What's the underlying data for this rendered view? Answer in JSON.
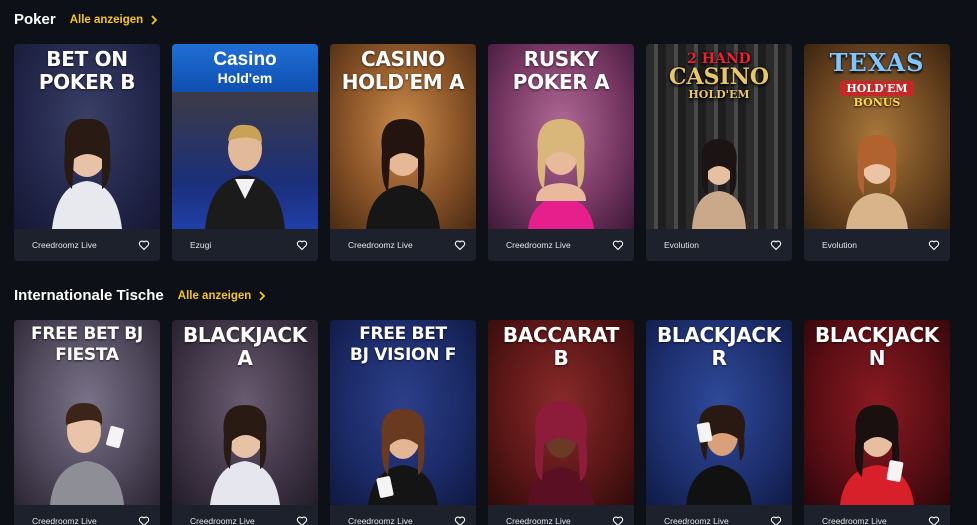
{
  "sections": [
    {
      "title": "Poker",
      "see_all": "Alle anzeigen",
      "cards": [
        {
          "title": "BET ON\nPOKER B",
          "provider": "Creedroomz Live"
        },
        {
          "title_l1": "Casino",
          "title_l2": "Hold'em",
          "provider": "Ezugi"
        },
        {
          "title": "CASINO\nHOLD'EM A",
          "provider": "Creedroomz Live"
        },
        {
          "title": "RUSKY\nPOKER A",
          "provider": "Creedroomz Live"
        },
        {
          "logo_l1": "2 HAND",
          "logo_l2": "CASINO",
          "logo_l3": "HOLD'EM",
          "provider": "Evolution"
        },
        {
          "logo_l1": "TEXAS",
          "logo_l2": "HOLD'EM",
          "logo_l3": "BONUS",
          "provider": "Evolution"
        }
      ]
    },
    {
      "title": "Internationale Tische",
      "see_all": "Alle anzeigen",
      "cards": [
        {
          "title": "FREE BET BJ\nFIESTA",
          "provider": "Creedroomz Live"
        },
        {
          "title": "BLACKJACK A",
          "provider": "Creedroomz Live"
        },
        {
          "title": "FREE BET\nBJ VISION F",
          "provider": "Creedroomz Live"
        },
        {
          "title": "BACCARAT B",
          "provider": "Creedroomz Live"
        },
        {
          "title": "BLACKJACK R",
          "provider": "Creedroomz Live"
        },
        {
          "title": "BLACKJACK N",
          "provider": "Creedroomz Live"
        }
      ]
    }
  ],
  "icons": {
    "see_all": "chevron-right-icon",
    "favorite": "heart-outline-icon"
  },
  "colors": {
    "background": "#0d1117",
    "accent": "#f5c518",
    "card_meta": "#1c212b"
  }
}
